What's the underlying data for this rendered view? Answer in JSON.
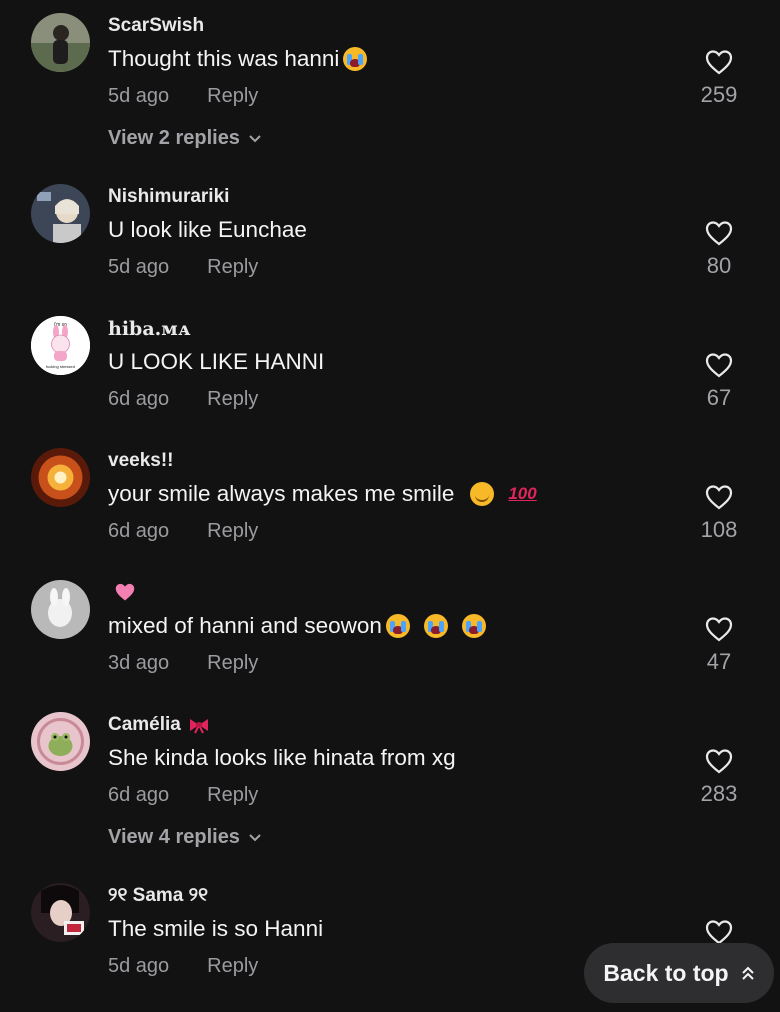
{
  "colors": {
    "background": "#121212",
    "muted": "#9b9ba0",
    "button_bg": "#2e2e30"
  },
  "comments": [
    {
      "username": "ScarSwish",
      "text": "Thought this was hanni",
      "time": "5d ago",
      "reply": "Reply",
      "likes": "259",
      "view_replies": "View 2 replies"
    },
    {
      "username": "Nishimurariki",
      "text": "U look like Eunchae",
      "time": "5d ago",
      "reply": "Reply",
      "likes": "80"
    },
    {
      "username": "𝐡𝐢𝐛𝐚.ᴍᴀ",
      "text": "U LOOK LIKE HANNI",
      "time": "6d ago",
      "reply": "Reply",
      "likes": "67",
      "avatar_text_top": "i'm so",
      "avatar_text_bottom": "fucking stressed"
    },
    {
      "username": "veeks!!",
      "text": "your smile always makes me smile",
      "time": "6d ago",
      "reply": "Reply",
      "likes": "108"
    },
    {
      "username": "",
      "text": "mixed of hanni and seowon",
      "time": "3d ago",
      "reply": "Reply",
      "likes": "47"
    },
    {
      "username": "Camélia",
      "text": "She kinda looks like hinata from xg",
      "time": "6d ago",
      "reply": "Reply",
      "likes": "283",
      "view_replies": "View 4 replies"
    },
    {
      "username": "୨୧ Sama ୨୧",
      "text": "The smile is so Hanni",
      "time": "5d ago",
      "reply": "Reply",
      "likes": ""
    }
  ],
  "back_to_top": "Back to top",
  "icons": {
    "like": "heart-outline-icon",
    "expand": "chevron-down-icon",
    "scroll_top": "double-chevron-up-icon"
  }
}
